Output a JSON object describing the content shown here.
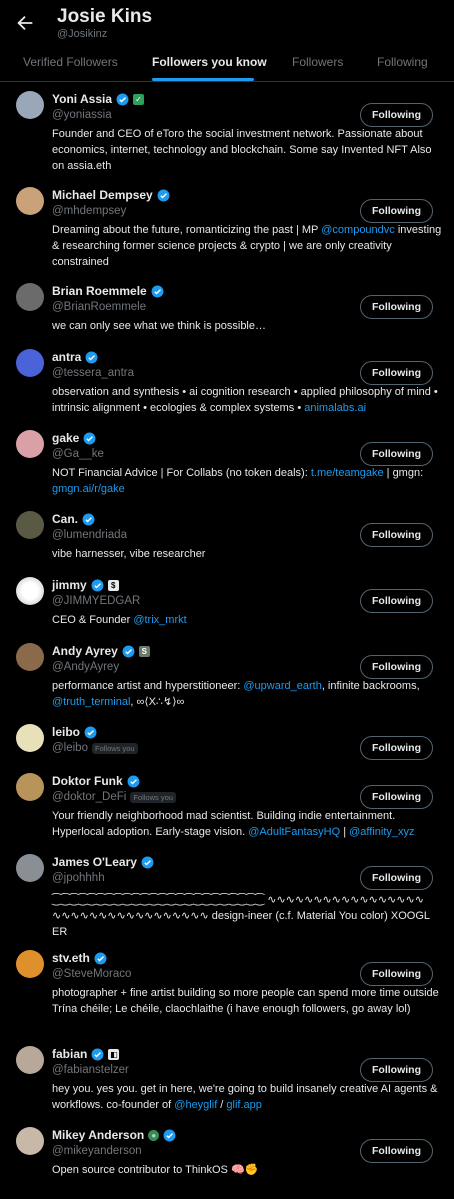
{
  "header": {
    "title": "Josie Kins",
    "handle": "@Josikinz"
  },
  "tabs": [
    "Verified Followers",
    "Followers you know",
    "Followers",
    "Following"
  ],
  "follow_label": "Following",
  "follows_you_label": "Follows you",
  "colors": {
    "accent": "#1d9bf0",
    "verified": "#1d9bf0",
    "muted": "#71767b",
    "background": "#000000"
  },
  "users": [
    {
      "name": "Yoni Assia",
      "handle": "@yoniassia",
      "bio": "Founder and CEO of eToro the social investment network. Passionate about economics, internet, technology and blockchain. Some say Invented NFT Also on assia.eth",
      "avatar_color": "#9aa7b8"
    },
    {
      "name": "Michael Dempsey",
      "handle": "@mhdempsey",
      "bio_parts": [
        "Dreaming about the future, romanticizing the past | MP ",
        "@compoundvc",
        " investing & researching former science projects & crypto | we are only creativity constrained"
      ],
      "avatar_color": "#c9a27a"
    },
    {
      "name": "Brian Roemmele",
      "handle": "@BrianRoemmele",
      "bio": "we can only see what we think is possible…",
      "avatar_color": "#6b6b6b"
    },
    {
      "name": "antra",
      "handle": "@tessera_antra",
      "bio_parts": [
        "observation and synthesis • ai cognition research • applied philosophy of mind • intrinsic alignment • ecologies & complex systems • ",
        "animalabs.ai"
      ],
      "avatar_color": "#4a63d8"
    },
    {
      "name": "gake",
      "handle": "@Ga__ke",
      "bio_parts": [
        "NOT Financial Advice | For Collabs (no token deals): ",
        "t.me/teamgake",
        " | gmgn: ",
        "gmgn.ai/r/gake"
      ],
      "avatar_color": "#d9a0a8"
    },
    {
      "name": "Can.",
      "handle": "@lumendriada",
      "bio": "vibe harnesser, vibe researcher",
      "avatar_color": "#5a5a44"
    },
    {
      "name": "jimmy",
      "handle": "@JIMMYEDGAR",
      "bio_parts": [
        "CEO & Founder ",
        "@trix_mrkt"
      ],
      "avatar_color": "#ffffff"
    },
    {
      "name": "Andy Ayrey",
      "handle": "@AndyAyrey",
      "bio_parts": [
        "performance artist and hyperstitioneer: ",
        "@upward_earth",
        ", infinite backrooms, ",
        "@truth_terminal",
        ", ∞⟨X∴↯⟩∞"
      ],
      "avatar_color": "#8a6a4a"
    },
    {
      "name": "leibo",
      "handle": "@leibo",
      "bio": "",
      "follows_you": true,
      "avatar_color": "#e8e0b8"
    },
    {
      "name": "Doktor Funk",
      "handle": "@doktor_DeFi",
      "bio_parts": [
        "Your friendly neighborhood mad scientist. Building indie entertainment. Hyperlocal adoption. Early-stage vision. ",
        "@AdultFantasyHQ",
        " | ",
        "@affinity_xyz"
      ],
      "follows_you": true,
      "avatar_color": "#b8945a"
    },
    {
      "name": "James O'Leary",
      "handle": "@jpohhhh",
      "bio": "⁐⁐⁐⁐⁐⁐⁐⁐⁐⁐⁐⁐⁐⁐⁐⁐⁐⁐⁐⁐⁐⁐⁐⁐ ∿∿∿∿∿∿∿∿∿∿∿∿∿∿∿∿∿∿∿∿∿∿∿∿∿∿∿∿∿∿∿∿∿∿ design-ineer (c.f. Material You color) XOOGLER",
      "avatar_color": "#8a8f96"
    },
    {
      "name": "stv.eth",
      "handle": "@SteveMoraco",
      "bio": "photographer + fine artist building so more people can spend more time outside Trína chéile; Le chéile, claochlaithe (i have enough followers, go away lol)",
      "avatar_color": "#e0902a"
    },
    {
      "name": "fabian",
      "handle": "@fabianstelzer",
      "bio_parts": [
        "hey you. yes you. get in here, we're going to build insanely creative AI agents & workflows. co-founder of ",
        "@heyglif",
        " / ",
        "glif.app"
      ],
      "avatar_color": "#b8a89a"
    },
    {
      "name": "Mikey Anderson",
      "handle": "@mikeyanderson",
      "bio": "Open source contributor to ThinkOS 🧠✊",
      "avatar_color": "#c8b8a8"
    }
  ]
}
